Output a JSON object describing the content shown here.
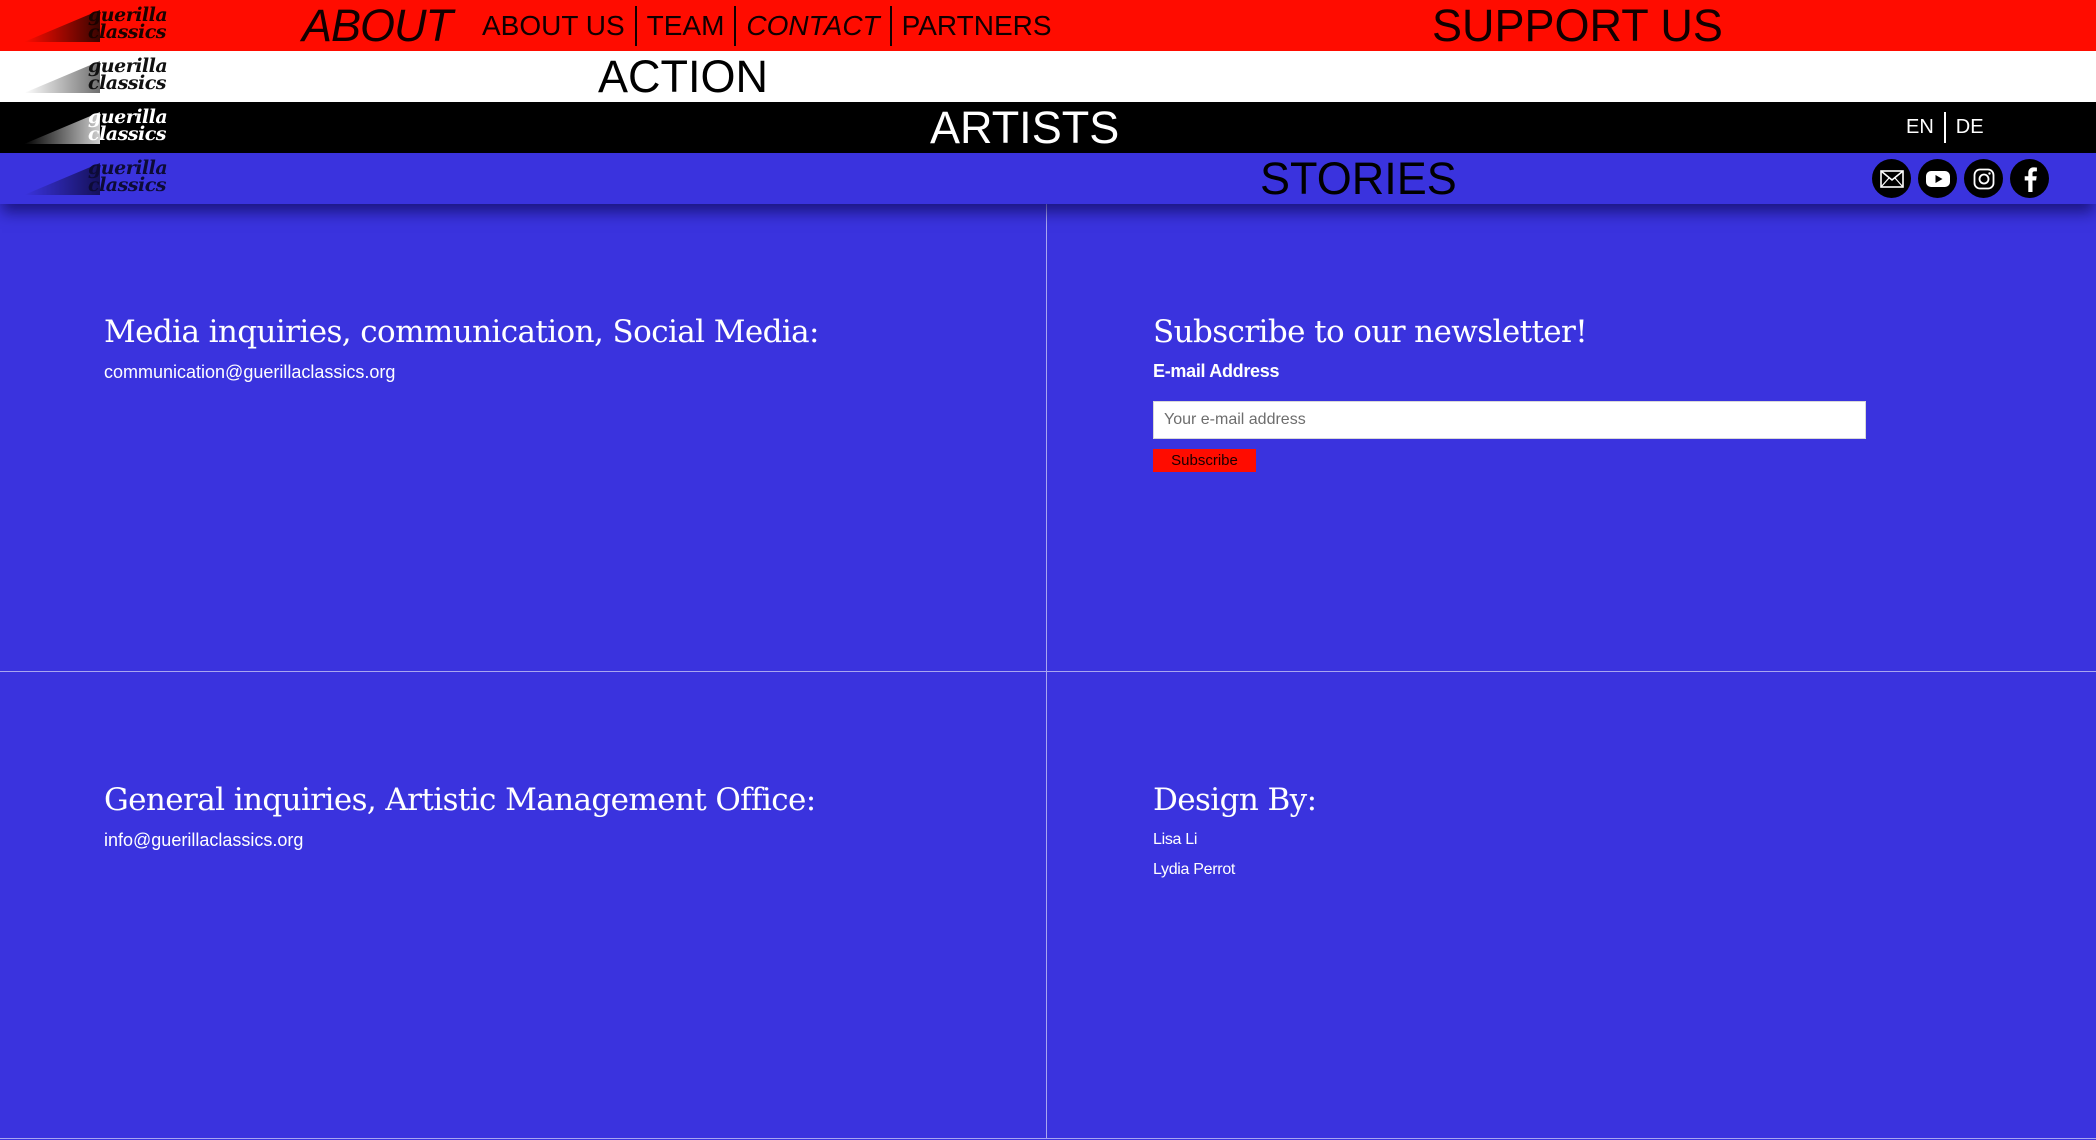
{
  "logo": {
    "line1": "guerilla",
    "line2": "classics"
  },
  "about_bar": {
    "title": "ABOUT",
    "nav": [
      {
        "label": "ABOUT US"
      },
      {
        "label": "TEAM"
      },
      {
        "label": "CONTACT"
      },
      {
        "label": "PARTNERS"
      }
    ],
    "support": "SUPPORT US"
  },
  "action_bar": {
    "title": "ACTION"
  },
  "artists_bar": {
    "title": "ARTISTS",
    "languages": [
      "EN",
      "DE"
    ]
  },
  "stories_bar": {
    "title": "STORIES",
    "socials": [
      "mail-icon",
      "youtube-icon",
      "instagram-icon",
      "facebook-icon"
    ]
  },
  "media": {
    "heading": "Media inquiries, communication, Social Media:",
    "email": "communication@guerillaclassics.org"
  },
  "newsletter": {
    "heading": "Subscribe to our newsletter!",
    "label": "E-mail Address",
    "placeholder": "Your e-mail address",
    "value": "",
    "button": "Subscribe"
  },
  "general": {
    "heading": "General inquiries, Artistic Management Office:",
    "email": "info@guerillaclassics.org"
  },
  "design": {
    "heading": "Design By:",
    "credits": [
      "Lisa Li",
      "Lydia Perrot"
    ]
  },
  "colors": {
    "red": "#ff0c00",
    "blue": "#3a33de",
    "black": "#000000",
    "white": "#ffffff"
  }
}
